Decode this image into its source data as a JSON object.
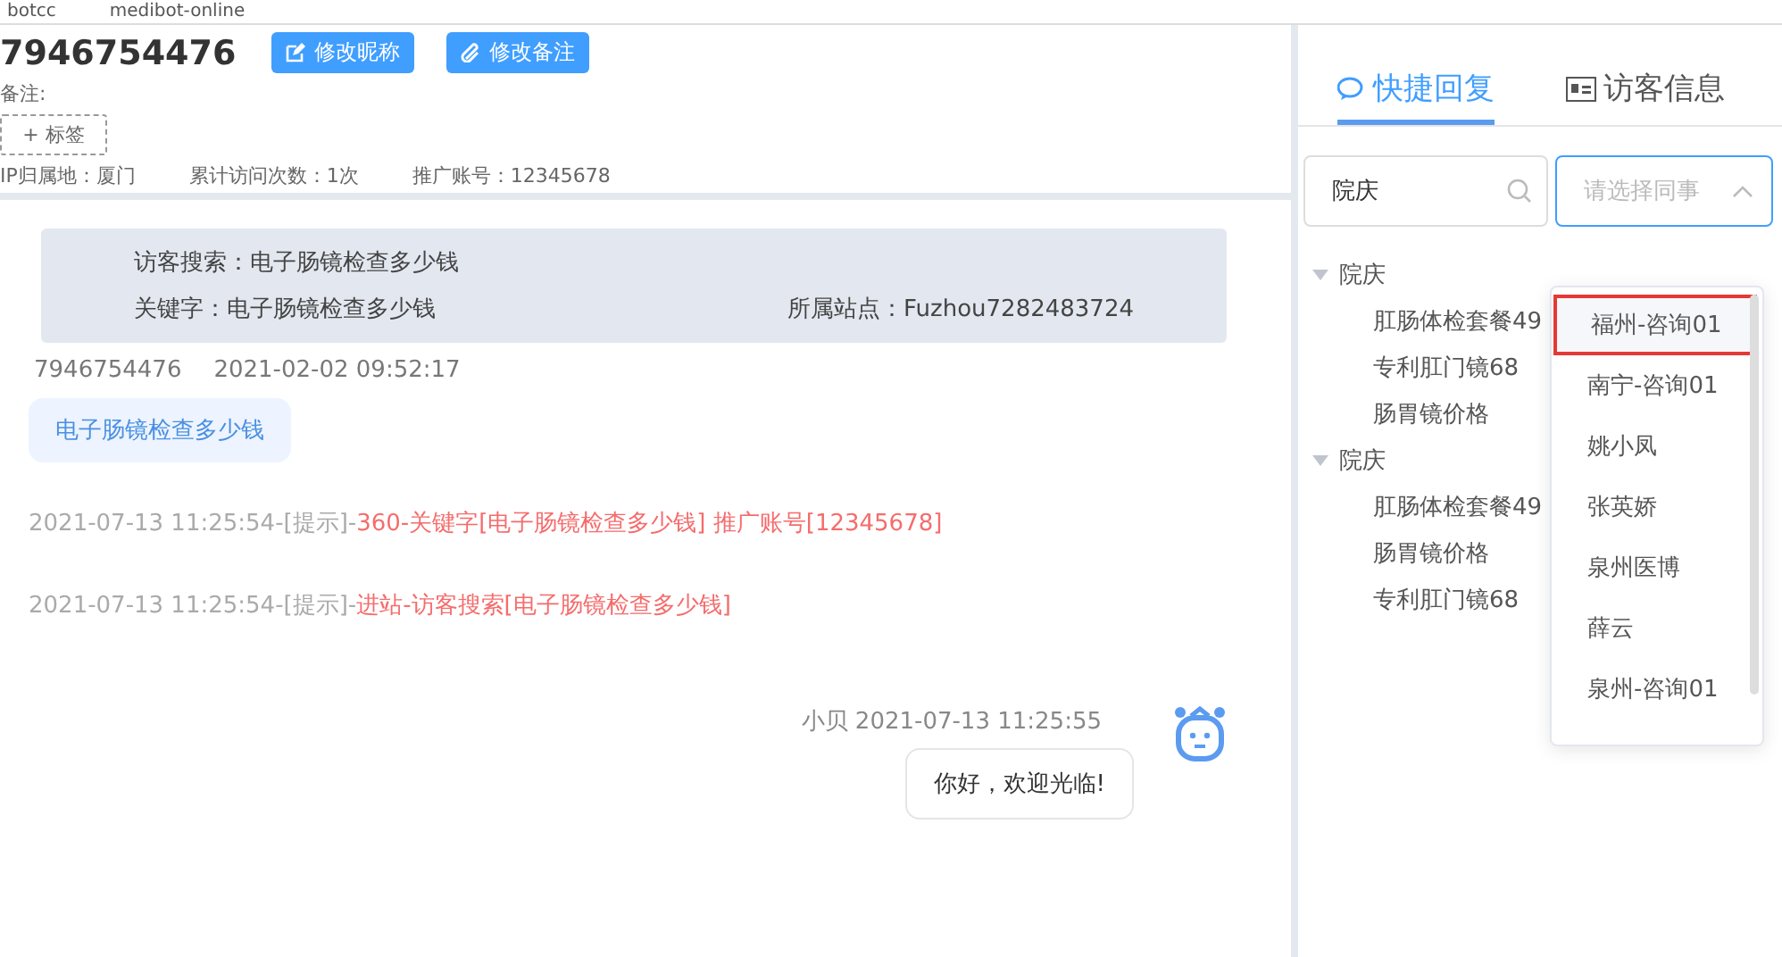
{
  "browser_tabs": [
    "botcc",
    "medibot-online"
  ],
  "visitor": {
    "name": "7946754476",
    "buttons": [
      {
        "label": "修改昵称",
        "kind": "edit"
      },
      {
        "label": "修改备注",
        "kind": "clip"
      }
    ],
    "note_label": "备注:",
    "tag_button": "+ 标签",
    "info": [
      "IP归属地：厦门",
      "累计访问次数：1次",
      "推广账号：12345678"
    ]
  },
  "source_card": {
    "search": "访客搜索：电子肠镜检查多少钱",
    "keyword": "关键字：电子肠镜检查多少钱",
    "site": "所属站点：Fuzhou7282483724"
  },
  "visitor_message": {
    "sender": "7946754476",
    "time": "2021-02-02 09:52:17",
    "text": "电子肠镜检查多少钱"
  },
  "system_logs": [
    {
      "prefix": "2021-07-13 11:25:54-[提示]-",
      "text": "360-关键字[电子肠镜检查多少钱] 推广账号[12345678]"
    },
    {
      "prefix": "2021-07-13 11:25:54-[提示]-",
      "text": "进站-访客搜索[电子肠镜检查多少钱]"
    }
  ],
  "bot_message": {
    "meta": "小贝 2021-07-13 11:25:55",
    "text": "你好，欢迎光临!"
  },
  "tabs": [
    {
      "label": "快捷回复",
      "selected": true,
      "kind": "chat"
    },
    {
      "label": "访客信息",
      "selected": false,
      "kind": "card"
    }
  ],
  "search": {
    "value": "院庆"
  },
  "colleague_select": {
    "placeholder": "请选择同事",
    "expanded": true
  },
  "tree": [
    {
      "label": "院庆",
      "expanded": true,
      "children": [
        {
          "label": "肛肠体检套餐49"
        },
        {
          "label": "专利肛门镜68"
        },
        {
          "label": "肠胃镜价格"
        }
      ]
    },
    {
      "label": "院庆",
      "expanded": true,
      "children": [
        {
          "label": "肛肠体检套餐49"
        },
        {
          "label": "肠胃镜价格"
        },
        {
          "label": "专利肛门镜68"
        }
      ]
    }
  ],
  "colleagues": [
    {
      "label": "福州-咨询01",
      "selected": true
    },
    {
      "label": "南宁-咨询01",
      "selected": false
    },
    {
      "label": "姚小凤",
      "selected": false
    },
    {
      "label": "张英娇",
      "selected": false
    },
    {
      "label": "泉州医博",
      "selected": false
    },
    {
      "label": "薛云",
      "selected": false
    },
    {
      "label": "泉州-咨询01",
      "selected": false
    }
  ]
}
